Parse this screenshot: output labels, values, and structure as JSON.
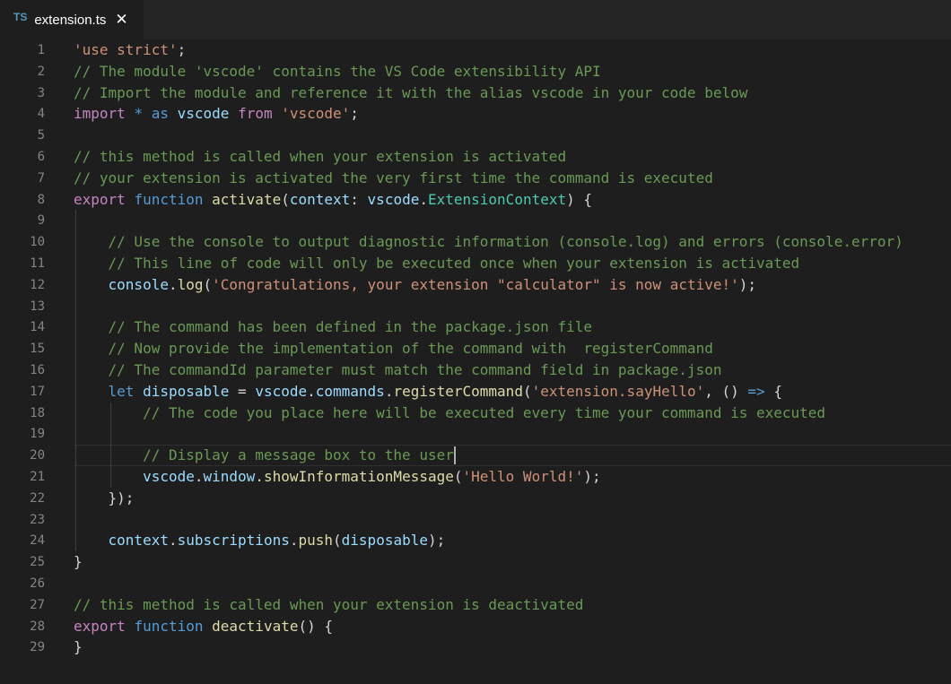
{
  "tab": {
    "lang_badge": "TS",
    "title": "extension.ts",
    "close_glyph": "✕"
  },
  "cursor_line": 20,
  "lines": [
    {
      "n": "1",
      "tokens": [
        [
          "str",
          "'use strict'"
        ],
        [
          "op",
          ";"
        ]
      ]
    },
    {
      "n": "2",
      "tokens": [
        [
          "cm",
          "// The module 'vscode' contains the VS Code extensibility API"
        ]
      ]
    },
    {
      "n": "3",
      "tokens": [
        [
          "cm",
          "// Import the module and reference it with the alias vscode in your code below"
        ]
      ]
    },
    {
      "n": "4",
      "tokens": [
        [
          "imp",
          "import"
        ],
        [
          "op",
          " "
        ],
        [
          "kw",
          "*"
        ],
        [
          "op",
          " "
        ],
        [
          "kw",
          "as"
        ],
        [
          "op",
          " "
        ],
        [
          "var",
          "vscode"
        ],
        [
          "op",
          " "
        ],
        [
          "imp",
          "from"
        ],
        [
          "op",
          " "
        ],
        [
          "str",
          "'vscode'"
        ],
        [
          "op",
          ";"
        ]
      ]
    },
    {
      "n": "5",
      "tokens": []
    },
    {
      "n": "6",
      "tokens": [
        [
          "cm",
          "// this method is called when your extension is activated"
        ]
      ]
    },
    {
      "n": "7",
      "tokens": [
        [
          "cm",
          "// your extension is activated the very first time the command is executed"
        ]
      ]
    },
    {
      "n": "8",
      "tokens": [
        [
          "imp",
          "export"
        ],
        [
          "op",
          " "
        ],
        [
          "kw",
          "function"
        ],
        [
          "op",
          " "
        ],
        [
          "fn",
          "activate"
        ],
        [
          "op",
          "("
        ],
        [
          "var",
          "context"
        ],
        [
          "op",
          ": "
        ],
        [
          "var",
          "vscode"
        ],
        [
          "op",
          "."
        ],
        [
          "ty",
          "ExtensionContext"
        ],
        [
          "op",
          ") {"
        ]
      ]
    },
    {
      "n": "9",
      "tokens": []
    },
    {
      "n": "10",
      "tokens": [
        [
          "op",
          "    "
        ],
        [
          "cm",
          "// Use the console to output diagnostic information (console.log) and errors (console.error)"
        ]
      ]
    },
    {
      "n": "11",
      "tokens": [
        [
          "op",
          "    "
        ],
        [
          "cm",
          "// This line of code will only be executed once when your extension is activated"
        ]
      ]
    },
    {
      "n": "12",
      "tokens": [
        [
          "op",
          "    "
        ],
        [
          "var",
          "console"
        ],
        [
          "op",
          "."
        ],
        [
          "fn",
          "log"
        ],
        [
          "op",
          "("
        ],
        [
          "str",
          "'Congratulations, your extension \"calculator\" is now active!'"
        ],
        [
          "op",
          ");"
        ]
      ]
    },
    {
      "n": "13",
      "tokens": []
    },
    {
      "n": "14",
      "tokens": [
        [
          "op",
          "    "
        ],
        [
          "cm",
          "// The command has been defined in the package.json file"
        ]
      ]
    },
    {
      "n": "15",
      "tokens": [
        [
          "op",
          "    "
        ],
        [
          "cm",
          "// Now provide the implementation of the command with  registerCommand"
        ]
      ]
    },
    {
      "n": "16",
      "tokens": [
        [
          "op",
          "    "
        ],
        [
          "cm",
          "// The commandId parameter must match the command field in package.json"
        ]
      ]
    },
    {
      "n": "17",
      "tokens": [
        [
          "op",
          "    "
        ],
        [
          "kw",
          "let"
        ],
        [
          "op",
          " "
        ],
        [
          "var",
          "disposable"
        ],
        [
          "op",
          " = "
        ],
        [
          "var",
          "vscode"
        ],
        [
          "op",
          "."
        ],
        [
          "var",
          "commands"
        ],
        [
          "op",
          "."
        ],
        [
          "fn",
          "registerCommand"
        ],
        [
          "op",
          "("
        ],
        [
          "str",
          "'extension.sayHello'"
        ],
        [
          "op",
          ", () "
        ],
        [
          "kw",
          "=>"
        ],
        [
          "op",
          " {"
        ]
      ]
    },
    {
      "n": "18",
      "tokens": [
        [
          "op",
          "        "
        ],
        [
          "cm",
          "// The code you place here will be executed every time your command is executed"
        ]
      ]
    },
    {
      "n": "19",
      "tokens": []
    },
    {
      "n": "20",
      "tokens": [
        [
          "op",
          "        "
        ],
        [
          "cm",
          "// Display a message box to the user"
        ]
      ]
    },
    {
      "n": "21",
      "tokens": [
        [
          "op",
          "        "
        ],
        [
          "var",
          "vscode"
        ],
        [
          "op",
          "."
        ],
        [
          "var",
          "window"
        ],
        [
          "op",
          "."
        ],
        [
          "fn",
          "showInformationMessage"
        ],
        [
          "op",
          "("
        ],
        [
          "str",
          "'Hello World!'"
        ],
        [
          "op",
          ");"
        ]
      ]
    },
    {
      "n": "22",
      "tokens": [
        [
          "op",
          "    });"
        ]
      ]
    },
    {
      "n": "23",
      "tokens": []
    },
    {
      "n": "24",
      "tokens": [
        [
          "op",
          "    "
        ],
        [
          "var",
          "context"
        ],
        [
          "op",
          "."
        ],
        [
          "var",
          "subscriptions"
        ],
        [
          "op",
          "."
        ],
        [
          "fn",
          "push"
        ],
        [
          "op",
          "("
        ],
        [
          "var",
          "disposable"
        ],
        [
          "op",
          ");"
        ]
      ]
    },
    {
      "n": "25",
      "tokens": [
        [
          "op",
          "}"
        ]
      ]
    },
    {
      "n": "26",
      "tokens": []
    },
    {
      "n": "27",
      "tokens": [
        [
          "cm",
          "// this method is called when your extension is deactivated"
        ]
      ]
    },
    {
      "n": "28",
      "tokens": [
        [
          "imp",
          "export"
        ],
        [
          "op",
          " "
        ],
        [
          "kw",
          "function"
        ],
        [
          "op",
          " "
        ],
        [
          "fn",
          "deactivate"
        ],
        [
          "op",
          "() {"
        ]
      ]
    },
    {
      "n": "29",
      "tokens": [
        [
          "op",
          "}"
        ]
      ]
    }
  ]
}
